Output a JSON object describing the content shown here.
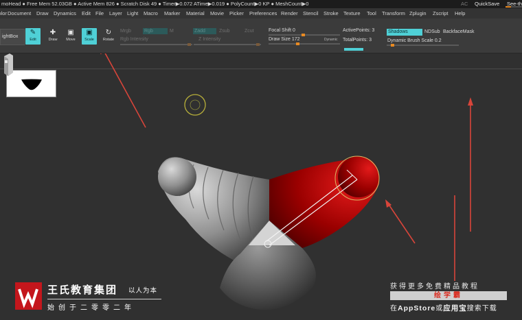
{
  "titlebar": {
    "status": "moHead  ● Free Mem 52.03GB ● Active Mem 826 ● Scratch Disk 49 ● Timer▶0.072 ATime▶0.019 ● PolyCount▶0 KP ● MeshCount▶0",
    "ac": "AC",
    "quicksave": "QuickSave",
    "see_through": "See-th"
  },
  "menu": [
    "Color",
    "Document",
    "Draw",
    "Dynamics",
    "Edit",
    "File",
    "Layer",
    "Light",
    "Macro",
    "Marker",
    "Material",
    "Movie",
    "Picker",
    "Preferences",
    "Render",
    "Stencil",
    "Stroke",
    "Texture",
    "Tool",
    "Transform",
    "Zplugin",
    "Zscript",
    "Help"
  ],
  "toolbar": {
    "lightbox": "ightBox",
    "edit": "Edit",
    "draw": "Draw",
    "move": "Move",
    "scale": "Scale",
    "rotate": "Rotate",
    "mrgb": "Mrgb",
    "rgb": "Rgb",
    "m": "M",
    "rgb_intensity": "Rgb Intensity",
    "zadd": "Zadd",
    "zsub": "Zsub",
    "zcut": "Zcut",
    "z_intensity": "Z Intensity",
    "focal_shift": "Focal Shift 0",
    "draw_size": "Draw Size 172",
    "dynamic": "Dynamic",
    "active_points": "ActivePoints: 3",
    "total_points": "TotalPoints: 3",
    "shadows": "Shadows",
    "ndsub": "NDSub",
    "backface_mask": "BackfaceMask",
    "dynamic_brush_scale": "Dynamic Brush Scale 0.2"
  },
  "watermark": {
    "title": "王氏教育集团",
    "slogan": "以人为本",
    "subtitle": "始创于二零零二年",
    "right_line1": "获得更多免费精品教程",
    "right_line2": "绘学霸",
    "right_line3a": "在",
    "right_line3b": "AppStore",
    "right_line3c": "或",
    "right_line3d": "应用宝",
    "right_line3e": "搜索下载"
  },
  "colors": {
    "accent": "#4fd0d6",
    "slider": "#e98a22",
    "mask_red": "#b00000",
    "arrow": "#d8453a"
  }
}
